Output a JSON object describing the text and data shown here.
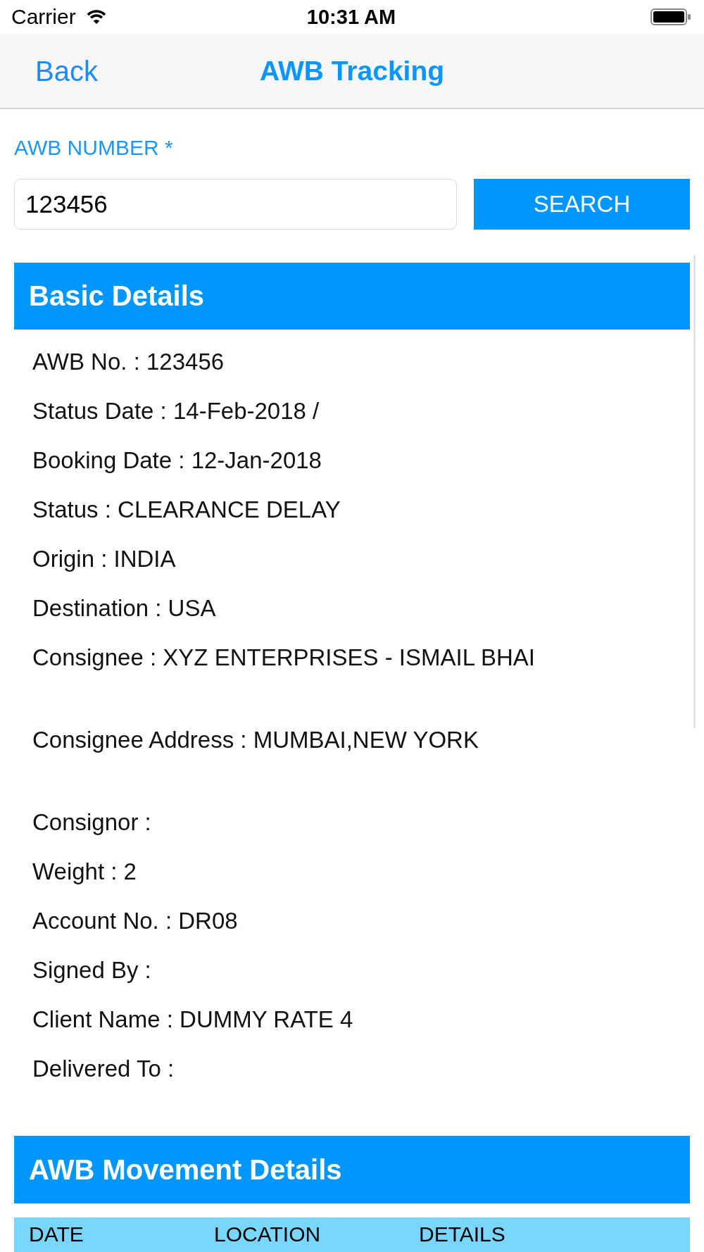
{
  "status_bar": {
    "carrier": "Carrier",
    "time": "10:31 AM"
  },
  "nav_bar": {
    "back": "Back",
    "title": "AWB Tracking"
  },
  "search_form": {
    "label": "AWB NUMBER *",
    "value": "123456",
    "button": "SEARCH"
  },
  "basic_details": {
    "title": "Basic Details",
    "lines": [
      "AWB No. : 123456",
      "Status Date : 14-Feb-2018 /",
      "Booking Date : 12-Jan-2018",
      "Status : CLEARANCE DELAY",
      "Origin : INDIA",
      "Destination : USA",
      "Consignee : XYZ ENTERPRISES - ISMAIL BHAI",
      "Consignee Address : MUMBAI,NEW YORK",
      "Consignor :",
      "Weight : 2",
      "Account No. : DR08",
      "Signed By :",
      "Client Name : DUMMY RATE 4",
      "Delivered To :"
    ]
  },
  "movement_details": {
    "title": "AWB Movement Details",
    "columns": [
      "DATE",
      "LOCATION",
      "DETAILS"
    ]
  }
}
